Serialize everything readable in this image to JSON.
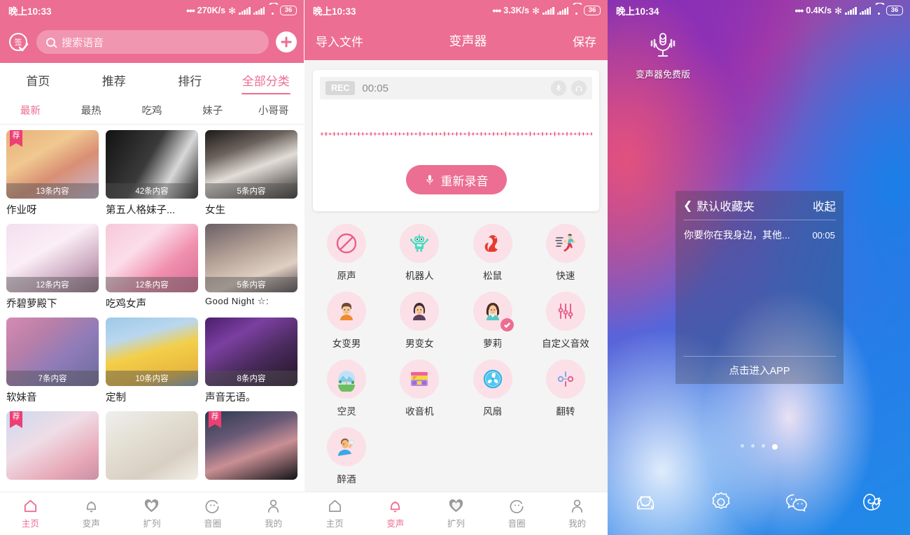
{
  "panel1": {
    "status": {
      "time": "晚上10:33",
      "net_speed": "270K/s",
      "battery": "36"
    },
    "header": {
      "sign_icon_label": "签",
      "search_placeholder": "搜索语音",
      "add_button_label": "+"
    },
    "main_tabs": [
      {
        "label": "首页",
        "active": false
      },
      {
        "label": "推荐",
        "active": false
      },
      {
        "label": "排行",
        "active": false
      },
      {
        "label": "全部分类",
        "active": true
      }
    ],
    "sub_tabs": [
      {
        "label": "最新",
        "active": true
      },
      {
        "label": "最热",
        "active": false
      },
      {
        "label": "吃鸡",
        "active": false
      },
      {
        "label": "妹子",
        "active": false
      },
      {
        "label": "小哥哥",
        "active": false
      }
    ],
    "cards": [
      {
        "title": "作业呀",
        "count": "13条内容",
        "badge": "荐"
      },
      {
        "title": "第五人格妹子...",
        "count": "42条内容",
        "badge": ""
      },
      {
        "title": "女生",
        "count": "5条内容",
        "badge": ""
      },
      {
        "title": "乔碧萝殿下",
        "count": "12条内容",
        "badge": ""
      },
      {
        "title": "吃鸡女声",
        "count": "12条内容",
        "badge": ""
      },
      {
        "title": "Good Night ☆:",
        "count": "5条内容",
        "badge": ""
      },
      {
        "title": "软妹音",
        "count": "7条内容",
        "badge": ""
      },
      {
        "title": "定制",
        "count": "10条内容",
        "badge": ""
      },
      {
        "title": "声音无语。",
        "count": "8条内容",
        "badge": ""
      },
      {
        "title": "",
        "count": "",
        "badge": "荐"
      },
      {
        "title": "",
        "count": "",
        "badge": ""
      },
      {
        "title": "",
        "count": "",
        "badge": "荐"
      }
    ],
    "bottom_nav": [
      {
        "label": "主页",
        "icon": "home-icon",
        "active": true
      },
      {
        "label": "变声",
        "icon": "bell-icon",
        "active": false
      },
      {
        "label": "扩列",
        "icon": "heart-icon",
        "active": false
      },
      {
        "label": "音圈",
        "icon": "circle-refresh-icon",
        "active": false
      },
      {
        "label": "我的",
        "icon": "person-icon",
        "active": false
      }
    ]
  },
  "panel2": {
    "status": {
      "time": "晚上10:33",
      "net_speed": "3.3K/s",
      "battery": "36"
    },
    "header": {
      "left": "导入文件",
      "title": "变声器",
      "right": "保存"
    },
    "recorder": {
      "rec_badge": "REC",
      "duration": "00:05",
      "mic_icon": "microphone-icon",
      "headphone_icon": "headphone-icon",
      "rerecord_label": "重新录音"
    },
    "effects": [
      {
        "label": "原声",
        "icon": "no-effect-icon",
        "selected": false
      },
      {
        "label": "机器人",
        "icon": "robot-icon",
        "selected": false
      },
      {
        "label": "松鼠",
        "icon": "squirrel-icon",
        "selected": false
      },
      {
        "label": "快速",
        "icon": "running-person-icon",
        "selected": false
      },
      {
        "label": "女变男",
        "icon": "male-face-icon",
        "selected": false
      },
      {
        "label": "男变女",
        "icon": "female-face-icon",
        "selected": false
      },
      {
        "label": "萝莉",
        "icon": "girl-face-icon",
        "selected": true
      },
      {
        "label": "自定义音效",
        "icon": "equalizer-icon",
        "selected": false
      },
      {
        "label": "空灵",
        "icon": "mountain-tent-icon",
        "selected": false
      },
      {
        "label": "收音机",
        "icon": "radio-icon",
        "selected": false
      },
      {
        "label": "风扇",
        "icon": "fan-icon",
        "selected": false
      },
      {
        "label": "翻转",
        "icon": "reverse-icon",
        "selected": false
      },
      {
        "label": "醉酒",
        "icon": "drinking-person-icon",
        "selected": false
      }
    ],
    "bottom_nav": [
      {
        "label": "主页",
        "icon": "home-icon",
        "active": false
      },
      {
        "label": "变声",
        "icon": "bell-icon",
        "active": true
      },
      {
        "label": "扩列",
        "icon": "heart-icon",
        "active": false
      },
      {
        "label": "音圈",
        "icon": "circle-refresh-icon",
        "active": false
      },
      {
        "label": "我的",
        "icon": "person-icon",
        "active": false
      }
    ]
  },
  "panel3": {
    "status": {
      "time": "晚上10:34",
      "net_speed": "0.4K/s",
      "battery": "36"
    },
    "app_shortcut": {
      "label": "变声器免费版",
      "icon": "voice-changer-app-icon"
    },
    "widget": {
      "back_icon": "chevron-left-icon",
      "title": "默认收藏夹",
      "collapse_label": "收起",
      "items": [
        {
          "name": "你要你在我身边，其他...",
          "duration": "00:05"
        }
      ],
      "footer_label": "点击进入APP"
    },
    "page_dots": {
      "total": 4,
      "active_index": 3
    },
    "dock": [
      {
        "icon": "camera-lens-icon"
      },
      {
        "icon": "gear-icon"
      },
      {
        "icon": "wechat-icon"
      },
      {
        "icon": "uc-browser-icon"
      }
    ]
  },
  "colors": {
    "accent_pink": "#ec6e92",
    "badge_pink": "#ec3f74",
    "fx_circle_bg": "#fbe0e8"
  }
}
